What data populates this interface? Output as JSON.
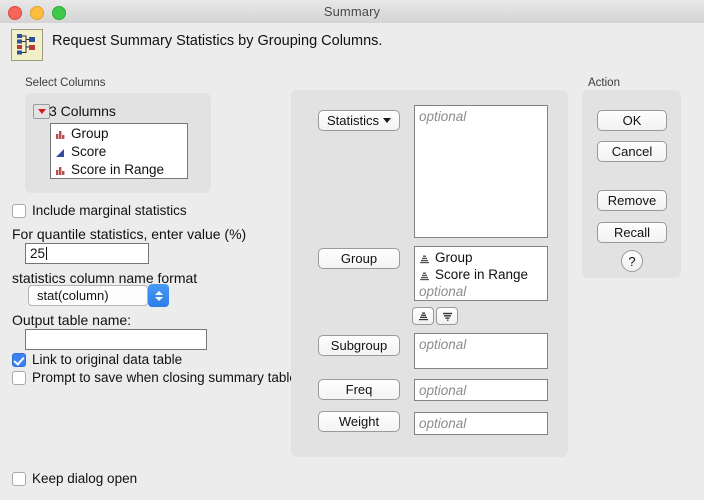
{
  "window": {
    "title": "Summary",
    "traffic_lights": [
      "close-red",
      "minimize-yellow",
      "zoom-green"
    ]
  },
  "header": {
    "icon": "summary-table-icon",
    "text": "Request Summary Statistics by Grouping Columns."
  },
  "select_columns": {
    "group_label": "Select Columns",
    "disclosure_icon": "red-triangle-down-icon",
    "count_label": "3 Columns",
    "columns": [
      {
        "name": "Group",
        "icon": "nominal-bars-icon"
      },
      {
        "name": "Score",
        "icon": "continuous-triangle-icon"
      },
      {
        "name": "Score in Range",
        "icon": "nominal-bars-icon"
      }
    ]
  },
  "options": {
    "include_marginal": {
      "label": "Include marginal statistics",
      "checked": false
    },
    "quantile_label": "For quantile statistics, enter value (%)",
    "quantile_value": "25",
    "name_format_label": "statistics column name format",
    "name_format_value": "stat(column)",
    "output_table_label": "Output table name:",
    "output_table_value": "",
    "link_original": {
      "label": "Link to original data table",
      "checked": true
    },
    "prompt_save": {
      "label": "Prompt to save when closing summary tables",
      "checked": false
    },
    "keep_dialog_open": {
      "label": "Keep dialog open",
      "checked": false
    }
  },
  "roles": {
    "statistics": {
      "button_label": "Statistics",
      "has_dropdown": true,
      "placeholder": "optional",
      "items": []
    },
    "group": {
      "button_label": "Group",
      "placeholder": "optional",
      "items": [
        {
          "name": "Group",
          "icon": "grey-nominal-bars-icon"
        },
        {
          "name": "Score in Range",
          "icon": "grey-nominal-bars-icon"
        }
      ],
      "sort_ascending_icon": "sort-pyramid-icon",
      "sort_filter_icon": "funnel-icon"
    },
    "subgroup": {
      "button_label": "Subgroup",
      "placeholder": "optional",
      "items": []
    },
    "freq": {
      "button_label": "Freq",
      "placeholder": "optional",
      "items": []
    },
    "weight": {
      "button_label": "Weight",
      "placeholder": "optional",
      "items": []
    }
  },
  "action": {
    "group_label": "Action",
    "ok": "OK",
    "cancel": "Cancel",
    "remove": "Remove",
    "recall": "Recall",
    "help": "?"
  },
  "colors": {
    "accent": "#3b82f6",
    "nominal_icon": "#b5504f",
    "continuous_icon": "#3b4a9c",
    "disclosure_red": "#d0201a",
    "panel_bg": "#e2e2e2",
    "window_bg": "#ececec"
  }
}
